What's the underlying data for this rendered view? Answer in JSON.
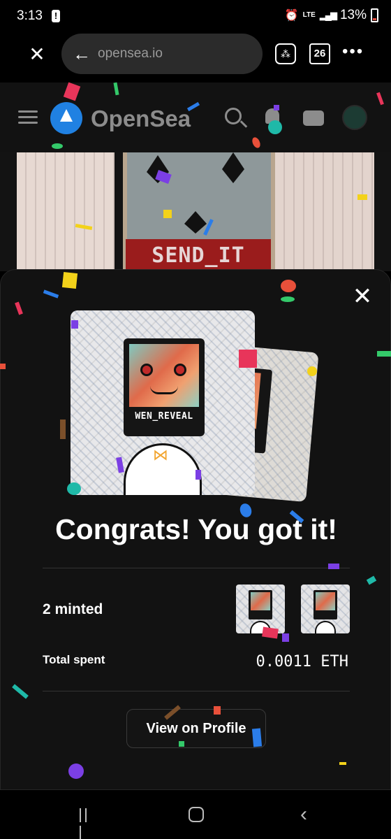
{
  "status_bar": {
    "time": "3:13",
    "alert_glyph": "!",
    "network": "LTE",
    "signal_glyph": "▂▄▆",
    "battery": "13%",
    "alarm_glyph": "⏰"
  },
  "browser": {
    "url": "opensea.io",
    "tab_count": "26",
    "close_glyph": "✕",
    "back_glyph": "←",
    "more_glyph": "•••",
    "qr_glyph": "⁂"
  },
  "header": {
    "brand": "OpenSea"
  },
  "banner": {
    "center_text": "SEND_IT"
  },
  "modal": {
    "close_glyph": "✕",
    "nft_label": "WEN_REVEAL",
    "bowtie_glyph": "⋈",
    "title": "Congrats! You got it!",
    "minted_label": "2 minted",
    "total_spent_label": "Total spent",
    "total_spent_value": "0.0011 ETH",
    "profile_button": "View on Profile"
  },
  "nav": {
    "back_glyph": "‹"
  },
  "colors": {
    "background": "#121212",
    "brand_blue": "#2081e2",
    "banner_red": "#9a1c1c",
    "accent_orange": "#f2a530"
  }
}
